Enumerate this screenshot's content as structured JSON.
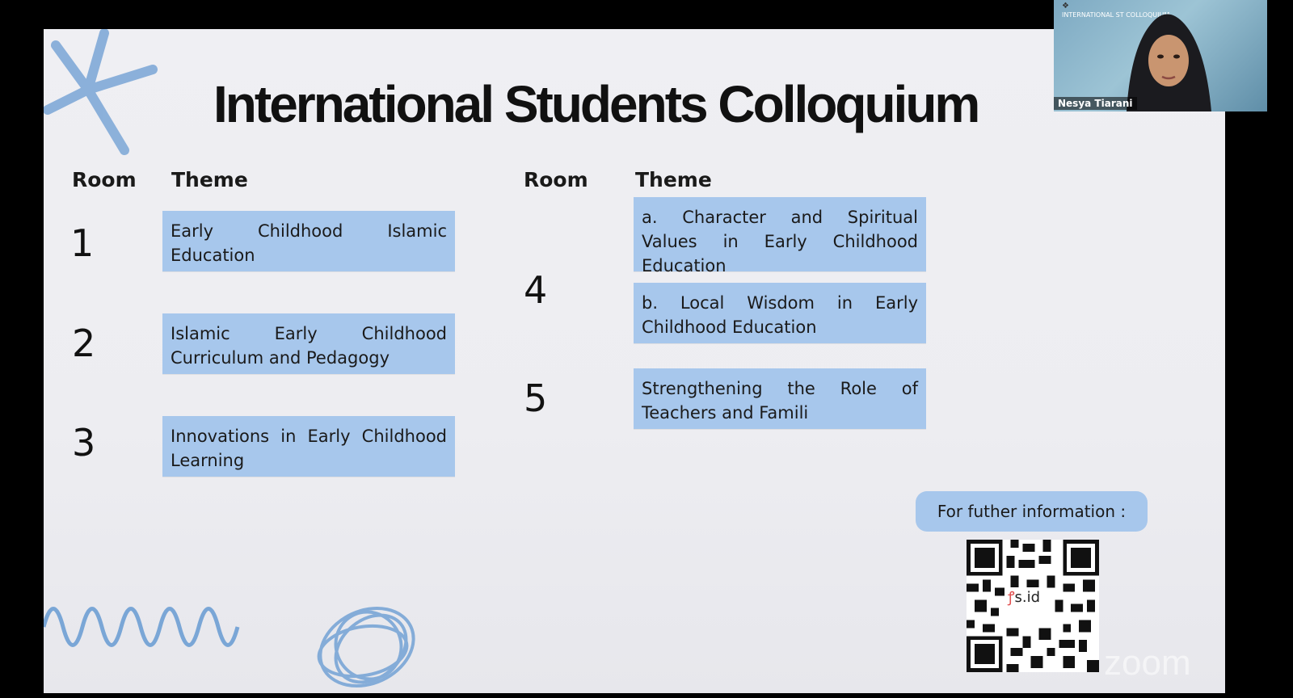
{
  "slide": {
    "title": "International Students Colloquium",
    "left_table": {
      "room_header": "Room",
      "theme_header": "Theme",
      "rows": [
        {
          "room": "1",
          "theme": "Early Childhood Islamic Education"
        },
        {
          "room": "2",
          "theme": "Islamic Early Childhood Curriculum and Pedagogy"
        },
        {
          "room": "3",
          "theme": "Innovations in Early Childhood Learning"
        }
      ]
    },
    "right_table": {
      "room_header": "Room",
      "theme_header": "Theme",
      "room4": {
        "room": "4",
        "theme_a": "a. Character and Spiritual Values in Early Childhood Education",
        "theme_b": "b. Local Wisdom in Early Childhood Education"
      },
      "room5": {
        "room": "5",
        "theme": "Strengthening the Role of Teachers and Famili"
      }
    },
    "info_label": "For futher information :",
    "qr_label": "s.id",
    "watermark": "zoom"
  },
  "participant": {
    "name": "Nesya Tiarani",
    "background_title": "INTERNATIONAL ST COLLOQUIUM"
  },
  "colors": {
    "box": "#a7c7ec",
    "slide_bg": "#efeff3",
    "decor": "#7aa6d6"
  }
}
